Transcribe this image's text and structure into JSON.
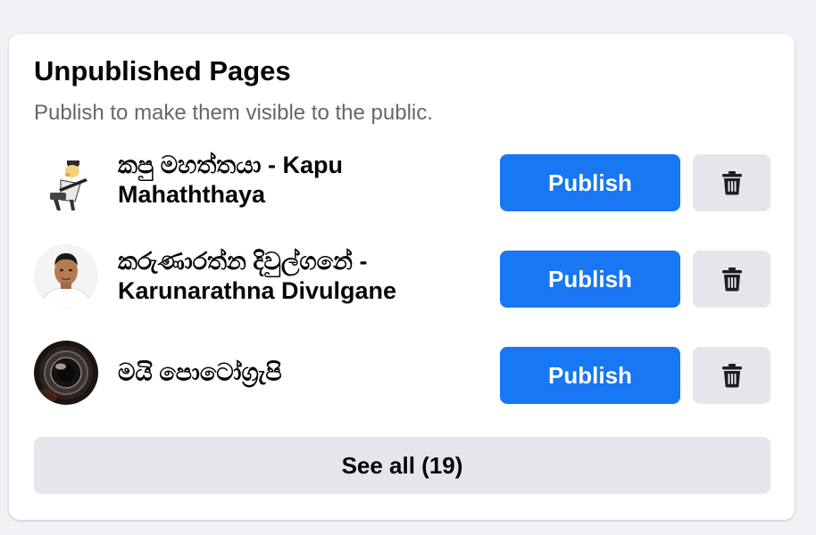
{
  "section": {
    "title": "Unpublished Pages",
    "subtitle": "Publish to make them visible to the public."
  },
  "pages": [
    {
      "name": "කපු මහත්තයා - Kapu Mahaththaya",
      "publish_label": "Publish",
      "avatar_icon": "cartoon-character-avatar",
      "delete_icon": "trash-icon"
    },
    {
      "name": "කරුණාරත්න දිවුල්ගනේ - Karunarathna Divulgane",
      "publish_label": "Publish",
      "avatar_icon": "person-photo-avatar",
      "delete_icon": "trash-icon"
    },
    {
      "name": "මයි පොටෝග්‍රැපි",
      "publish_label": "Publish",
      "avatar_icon": "camera-lens-avatar",
      "delete_icon": "trash-icon"
    }
  ],
  "see_all_label": "See all (19)",
  "colors": {
    "primary": "#1877f2",
    "secondary_button": "#e4e6eb",
    "background": "#f0f2f5",
    "secondary_text": "#65676b"
  }
}
